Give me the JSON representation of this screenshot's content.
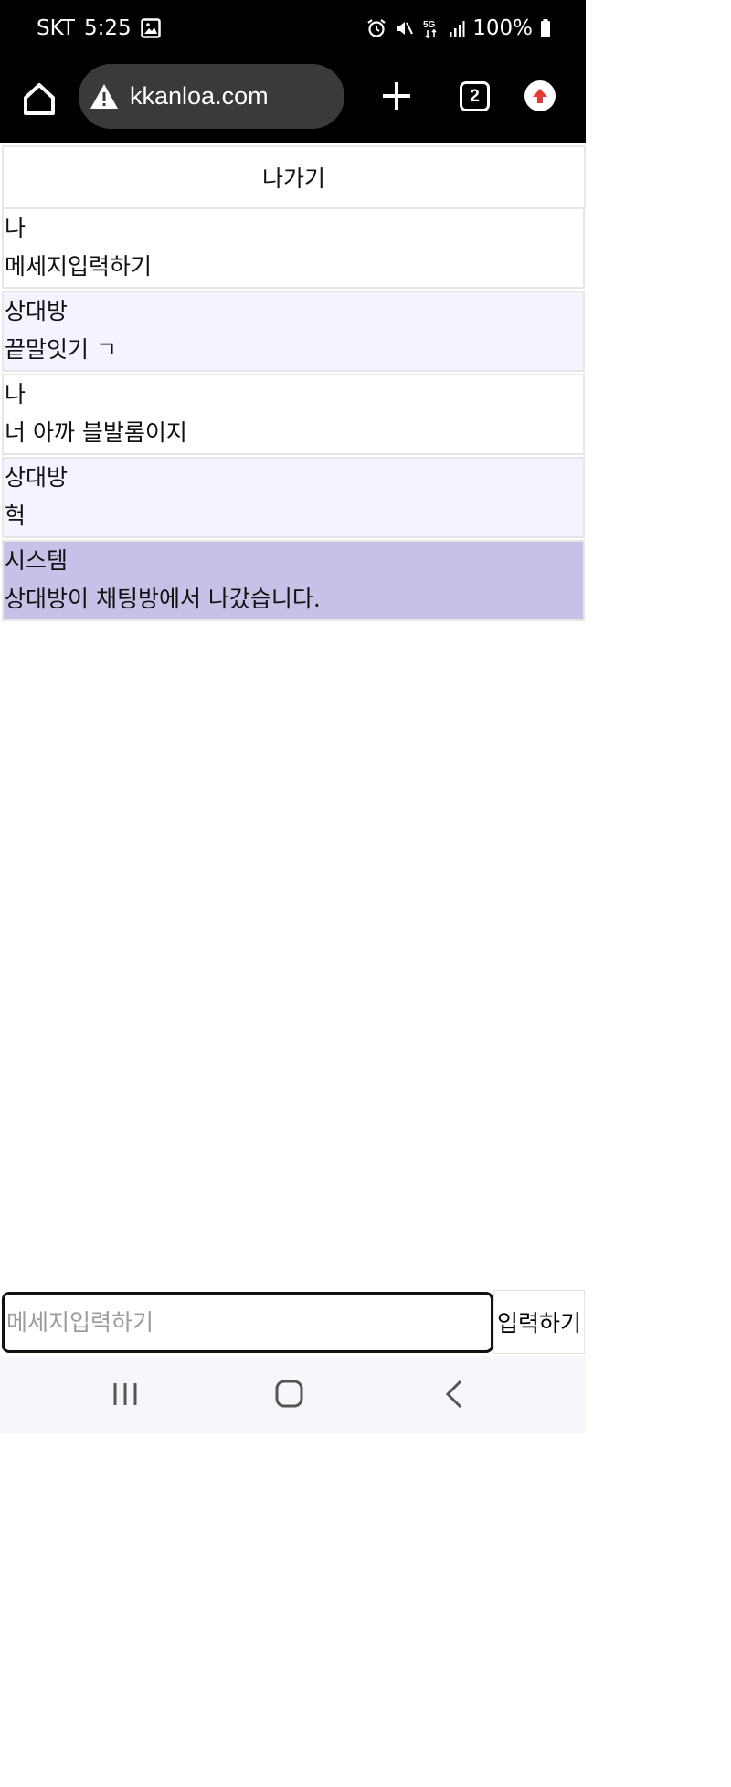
{
  "status_bar": {
    "carrier": "SKT",
    "time": "5:25",
    "network": "5G",
    "battery": "100%"
  },
  "browser": {
    "url": "kkanloa.com",
    "tab_count": "2"
  },
  "chat": {
    "exit_label": "나가기",
    "messages": [
      {
        "sender": "나",
        "text": "메세지입력하기",
        "kind": "me"
      },
      {
        "sender": "상대방",
        "text": "끝말잇기 ㄱ",
        "kind": "other"
      },
      {
        "sender": "나",
        "text": "너 아까 블발롬이지",
        "kind": "me"
      },
      {
        "sender": "상대방",
        "text": "헉",
        "kind": "other"
      },
      {
        "sender": "시스템",
        "text": "상대방이 채팅방에서 나갔습니다.",
        "kind": "system"
      }
    ]
  },
  "composer": {
    "placeholder": "메세지입력하기",
    "value": "",
    "send_label": "입력하기"
  },
  "colors": {
    "my_message_bg": "#ffffff",
    "partner_message_bg": "#f5f3ff",
    "system_message_bg": "#c8c0e7",
    "upgrade_accent": "#e53935"
  }
}
